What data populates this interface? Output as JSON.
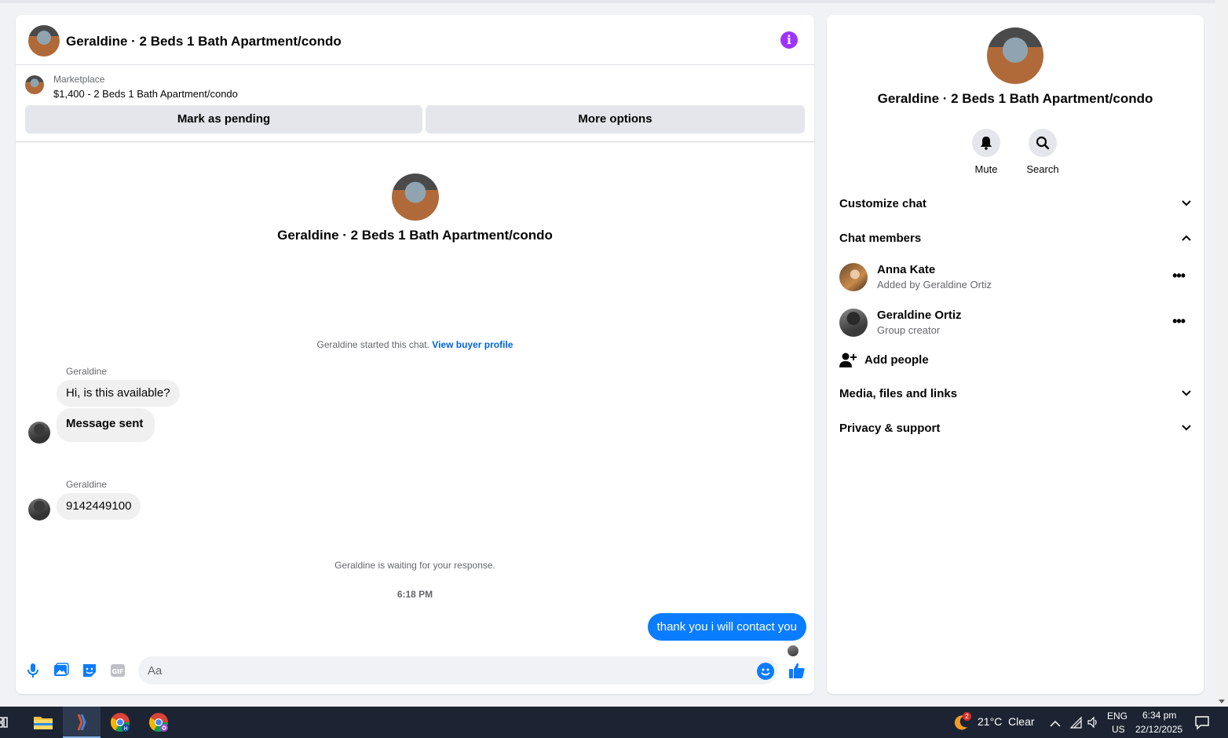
{
  "header": {
    "title": "Geraldine · 2 Beds 1 Bath Apartment/condo"
  },
  "marketplace": {
    "label": "Marketplace",
    "listing": "$1,400 - 2 Beds 1 Bath Apartment/condo",
    "pending_label": "Mark as pending",
    "more_label": "More options"
  },
  "intro": {
    "title": "Geraldine · 2 Beds 1 Bath Apartment/condo",
    "started_text": "Geraldine started this chat.",
    "buyer_link": "View buyer profile"
  },
  "messages": {
    "group1_sender": "Geraldine",
    "group1_msg1": "Hi, is this available?",
    "group1_msg2": "Message sent",
    "group2_sender": "Geraldine",
    "group2_msg1": "9142449100",
    "waiting": "Geraldine is waiting for your response.",
    "time": "6:18 PM",
    "outgoing": "thank you i will contact you"
  },
  "composer": {
    "placeholder": "Aa"
  },
  "sidebar": {
    "title": "Geraldine · 2 Beds 1 Bath Apartment/condo",
    "mute_label": "Mute",
    "search_label": "Search",
    "customize": "Customize chat",
    "members_title": "Chat members",
    "members": [
      {
        "name": "Anna Kate",
        "sub": "Added by Geraldine Ortiz"
      },
      {
        "name": "Geraldine Ortiz",
        "sub": "Group creator"
      }
    ],
    "add_people": "Add people",
    "media": "Media, files and links",
    "privacy": "Privacy & support"
  },
  "taskbar": {
    "weather_badge": "2",
    "weather": "21°C  Clear",
    "lang": "ENG",
    "region": "US",
    "time": "6:34 pm",
    "date": "22/12/2025"
  },
  "colors": {
    "accent": "#0a7cff",
    "link": "#0064d1",
    "info": "#a033ff",
    "taskbar": "#1c2433"
  }
}
